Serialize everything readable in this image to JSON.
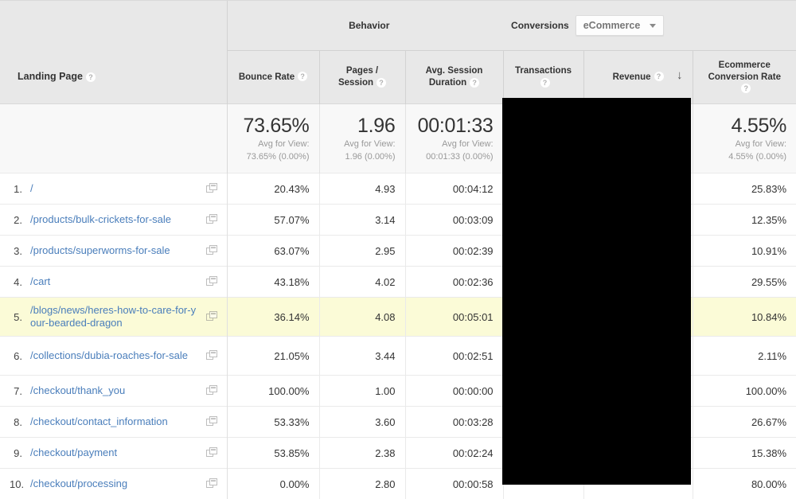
{
  "groups": {
    "dimension_label": "Landing Page",
    "behavior_label": "Behavior",
    "conversions_label": "Conversions",
    "conversions_selector_value": "eCommerce",
    "help_glyph": "?",
    "sort_arrow_glyph": "↓"
  },
  "columns": {
    "bounce_rate": "Bounce Rate",
    "pages_session_line1": "Pages /",
    "pages_session_line2": "Session",
    "avg_session_line1": "Avg. Session",
    "avg_session_line2": "Duration",
    "transactions": "Transactions",
    "revenue": "Revenue",
    "ecom_conv_line1": "Ecommerce",
    "ecom_conv_line2": "Conversion Rate"
  },
  "summary": {
    "avg_for_view_label": "Avg for View:",
    "bounce_rate": {
      "value": "73.65%",
      "compare": "73.65% (0.00%)"
    },
    "pages_session": {
      "value": "1.96",
      "compare": "1.96 (0.00%)"
    },
    "avg_session_duration": {
      "value": "00:01:33",
      "compare": "00:01:33 (0.00%)"
    },
    "ecom_conversion_rate": {
      "value": "4.55%",
      "compare": "4.55% (0.00%)"
    }
  },
  "rows": [
    {
      "index": "1.",
      "page": "/",
      "bounce_rate": "20.43%",
      "pages_session": "4.93",
      "avg_session_duration": "00:04:12",
      "ecom_conversion_rate": "25.83%",
      "highlighted": false,
      "tall": false
    },
    {
      "index": "2.",
      "page": "/products/bulk-crickets-for-sale",
      "bounce_rate": "57.07%",
      "pages_session": "3.14",
      "avg_session_duration": "00:03:09",
      "ecom_conversion_rate": "12.35%",
      "highlighted": false,
      "tall": false
    },
    {
      "index": "3.",
      "page": "/products/superworms-for-sale",
      "bounce_rate": "63.07%",
      "pages_session": "2.95",
      "avg_session_duration": "00:02:39",
      "ecom_conversion_rate": "10.91%",
      "highlighted": false,
      "tall": false
    },
    {
      "index": "4.",
      "page": "/cart",
      "bounce_rate": "43.18%",
      "pages_session": "4.02",
      "avg_session_duration": "00:02:36",
      "ecom_conversion_rate": "29.55%",
      "highlighted": false,
      "tall": false
    },
    {
      "index": "5.",
      "page": "/blogs/news/heres-how-to-care-for-your-bearded-dragon",
      "bounce_rate": "36.14%",
      "pages_session": "4.08",
      "avg_session_duration": "00:05:01",
      "ecom_conversion_rate": "10.84%",
      "highlighted": true,
      "tall": true
    },
    {
      "index": "6.",
      "page": "/collections/dubia-roaches-for-sale",
      "bounce_rate": "21.05%",
      "pages_session": "3.44",
      "avg_session_duration": "00:02:51",
      "ecom_conversion_rate": "2.11%",
      "highlighted": false,
      "tall": true
    },
    {
      "index": "7.",
      "page": "/checkout/thank_you",
      "bounce_rate": "100.00%",
      "pages_session": "1.00",
      "avg_session_duration": "00:00:00",
      "ecom_conversion_rate": "100.00%",
      "highlighted": false,
      "tall": false
    },
    {
      "index": "8.",
      "page": "/checkout/contact_information",
      "bounce_rate": "53.33%",
      "pages_session": "3.60",
      "avg_session_duration": "00:03:28",
      "ecom_conversion_rate": "26.67%",
      "highlighted": false,
      "tall": false
    },
    {
      "index": "9.",
      "page": "/checkout/payment",
      "bounce_rate": "53.85%",
      "pages_session": "2.38",
      "avg_session_duration": "00:02:24",
      "ecom_conversion_rate": "15.38%",
      "highlighted": false,
      "tall": false
    },
    {
      "index": "10.",
      "page": "/checkout/processing",
      "bounce_rate": "0.00%",
      "pages_session": "2.80",
      "avg_session_duration": "00:00:58",
      "ecom_conversion_rate": "80.00%",
      "highlighted": false,
      "tall": false
    }
  ],
  "colors": {
    "link": "#4a7ebb",
    "header_bg": "#e8e8e8",
    "highlight_row": "#fbfbd7",
    "summary_bg": "#f8f8f8",
    "redaction": "#000000"
  }
}
